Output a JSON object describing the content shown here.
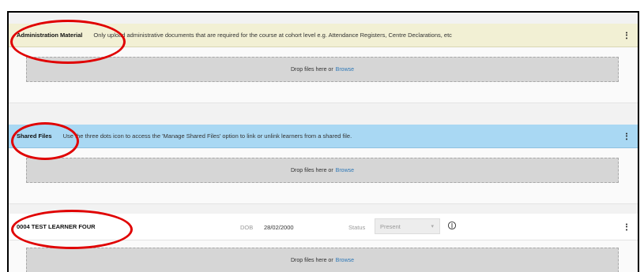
{
  "admin": {
    "title": "Administration Material",
    "description": "Only upload administrative documents that are required for the course at cohort level e.g. Attendance Registers, Centre Declarations, etc",
    "header_color": "#f2f0d4"
  },
  "shared": {
    "title": "Shared Files",
    "description": "Use the three dots icon to access the 'Manage Shared Files' option to link or unlink learners from a shared file.",
    "header_color": "#a9d8f3"
  },
  "dropzone": {
    "text": "Drop files here or",
    "browse": "Browse"
  },
  "learner": {
    "name": "0004 TEST LEARNER FOUR",
    "dob_label": "DOB",
    "dob": "28/02/2000",
    "status_label": "Status",
    "status_value": "Present"
  },
  "icons": {
    "menu": "kebab-menu-icon",
    "info": "info-icon",
    "dropdown": "chevron-down-icon"
  },
  "highlight_color": "#e00000"
}
